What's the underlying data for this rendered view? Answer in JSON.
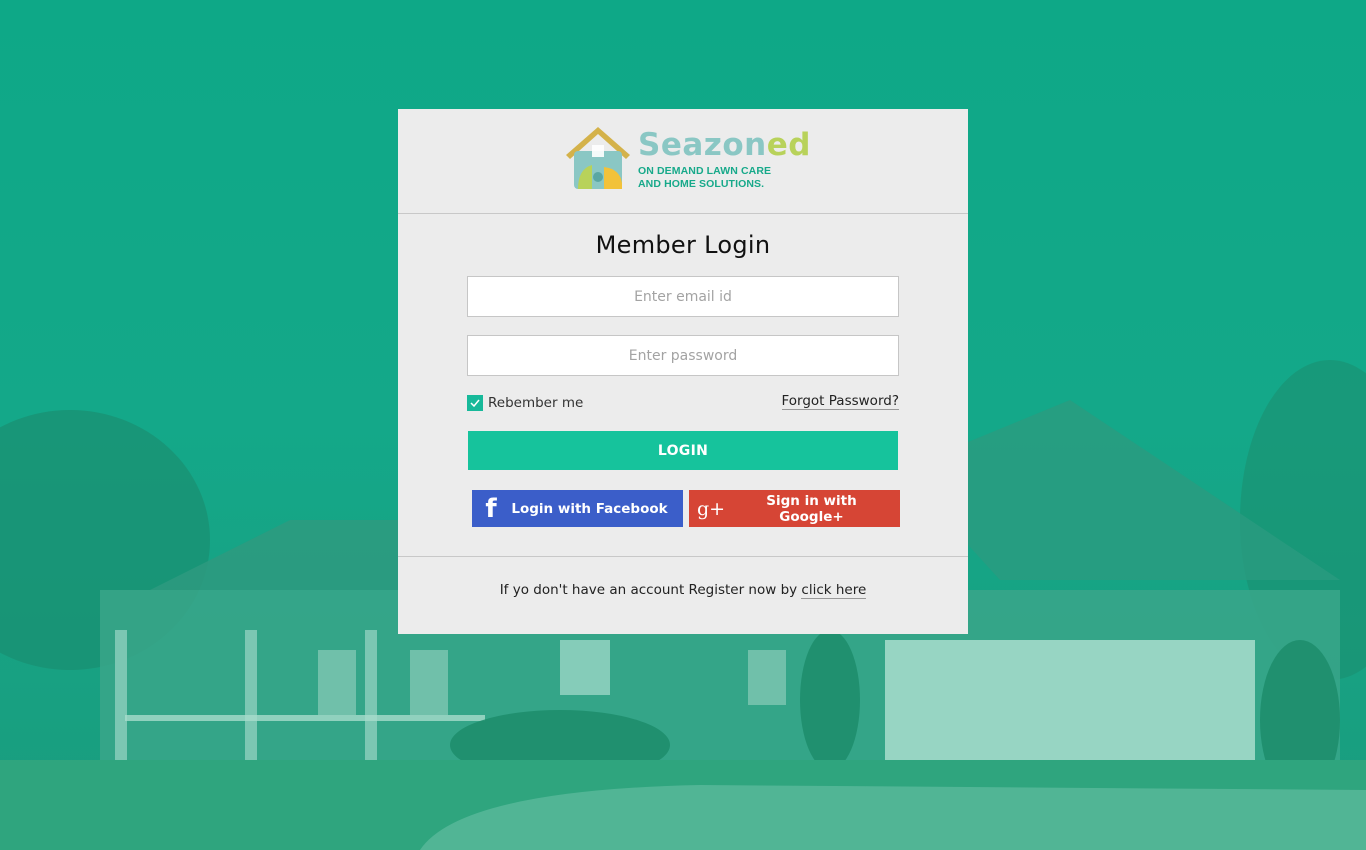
{
  "brand": {
    "name_main": "Seazon",
    "name_end": "ed",
    "tagline_line1": "ON DEMAND LAWN CARE",
    "tagline_line2": "AND HOME SOLUTIONS."
  },
  "form": {
    "title": "Member Login",
    "email_placeholder": "Enter email id",
    "password_placeholder": "Enter password",
    "remember_label": "Rebember me",
    "remember_checked": true,
    "forgot_label": "Forgot Password?",
    "login_label": "LOGIN"
  },
  "social": {
    "facebook_icon": "f",
    "facebook_label": "Login with Facebook",
    "google_icon": "g+",
    "google_label": "Sign in with Google+"
  },
  "footer": {
    "register_text": "If yo don't have an account Register now by ",
    "register_link": "click here"
  },
  "colors": {
    "accent": "#16c39c",
    "facebook": "#3b5ec9",
    "google": "#d64535",
    "background_tint": "#0fa88a"
  },
  "icons": [
    "house-logo-icon",
    "checkmark-icon",
    "facebook-icon",
    "google-plus-icon"
  ]
}
